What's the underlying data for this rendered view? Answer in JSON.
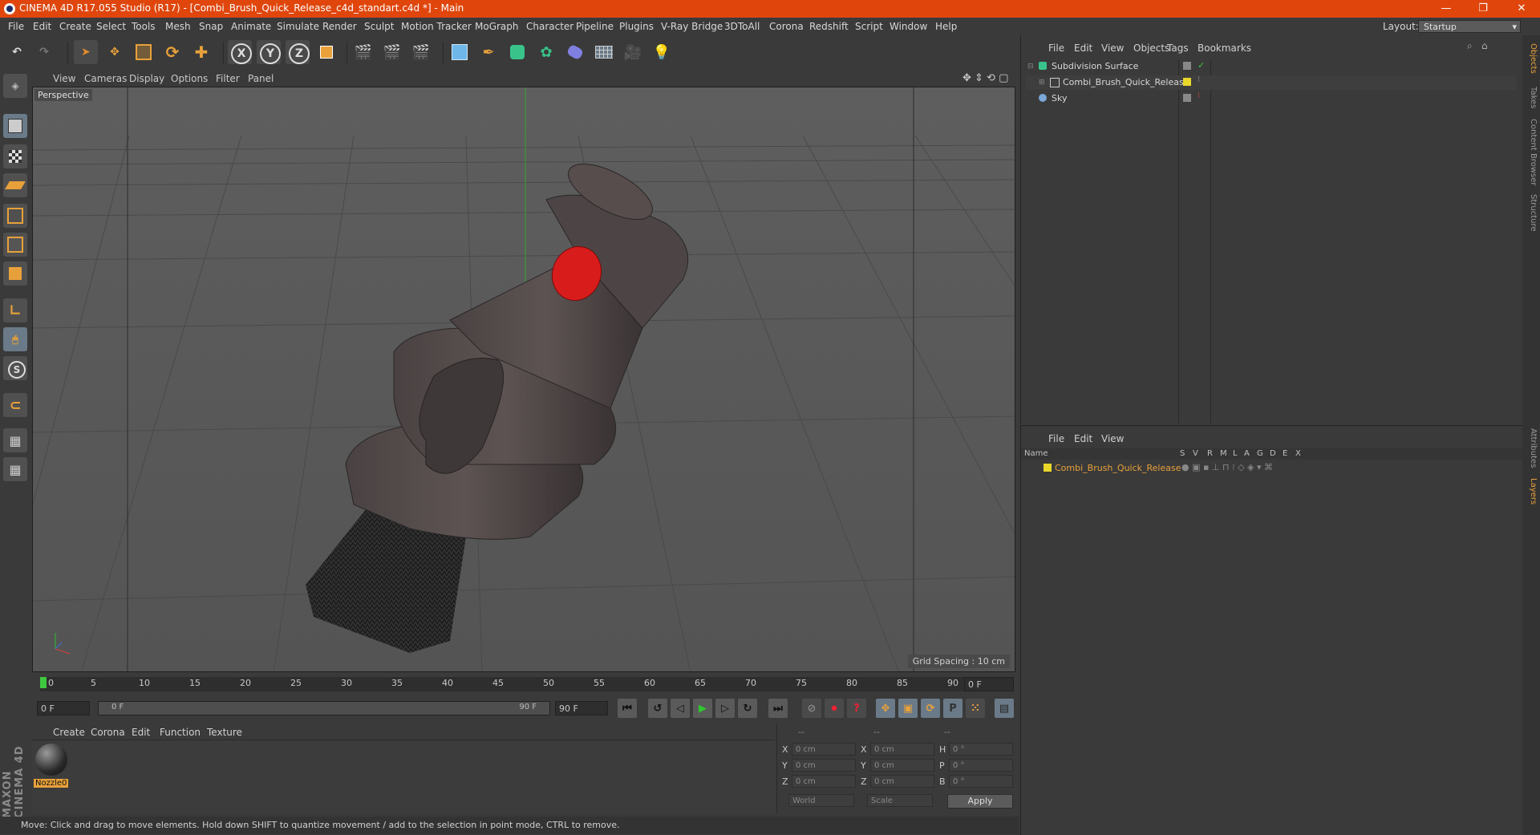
{
  "window": {
    "title": "CINEMA 4D R17.055 Studio (R17) - [Combi_Brush_Quick_Release_c4d_standart.c4d *] - Main",
    "minimize": "—",
    "restore": "❐",
    "close": "✕"
  },
  "menubar": {
    "items": [
      "File",
      "Edit",
      "Create",
      "Select",
      "Tools",
      "Mesh",
      "Snap",
      "Animate",
      "Simulate",
      "Render",
      "Sculpt",
      "Motion Tracker",
      "MoGraph",
      "Character",
      "Pipeline",
      "Plugins",
      "V-Ray Bridge",
      "3DToAll",
      "Corona",
      "Redshift",
      "Script",
      "Window",
      "Help"
    ],
    "layout_label": "Layout:",
    "layout_value": "Startup"
  },
  "toolbar": {
    "axis_x": "X",
    "axis_y": "Y",
    "axis_z": "Z"
  },
  "viewport": {
    "menu": [
      "View",
      "Cameras",
      "Display",
      "Options",
      "Filter",
      "Panel"
    ],
    "camera": "Perspective",
    "grid_spacing": "Grid Spacing : 10 cm"
  },
  "timeline": {
    "ticks": [
      "0",
      "5",
      "10",
      "15",
      "20",
      "25",
      "30",
      "35",
      "40",
      "45",
      "50",
      "55",
      "60",
      "65",
      "70",
      "75",
      "80",
      "85",
      "90"
    ],
    "current_frame": "0 F",
    "start_field": "0 F",
    "range_start": "0 F",
    "range_end": "90 F",
    "end_field": "90 F"
  },
  "material_manager": {
    "menu": [
      "Create",
      "Corona",
      "Edit",
      "Function",
      "Texture"
    ],
    "materials": [
      {
        "name": "Nozzle0"
      }
    ]
  },
  "coordinates": {
    "headers": [
      "--",
      "--",
      "--"
    ],
    "rows": [
      {
        "a": "X",
        "av": "0 cm",
        "b": "X",
        "bv": "0 cm",
        "c": "H",
        "cv": "0 °"
      },
      {
        "a": "Y",
        "av": "0 cm",
        "b": "Y",
        "bv": "0 cm",
        "c": "P",
        "cv": "0 °"
      },
      {
        "a": "Z",
        "av": "0 cm",
        "b": "Z",
        "bv": "0 cm",
        "c": "B",
        "cv": "0 °"
      }
    ],
    "world": "World",
    "scale": "Scale",
    "apply": "Apply"
  },
  "status": "Move: Click and drag to move elements. Hold down SHIFT to quantize movement / add to the selection in point mode, CTRL to remove.",
  "object_manager": {
    "menu": [
      "File",
      "Edit",
      "View",
      "Objects",
      "Tags",
      "Bookmarks"
    ],
    "objects": [
      {
        "name": "Subdivision Surface",
        "color": "#39c38a"
      },
      {
        "name": "Combi_Brush_Quick_Release",
        "color": "#cfcfcf"
      },
      {
        "name": "Sky",
        "color": "#7aa6d8"
      }
    ]
  },
  "layer_manager": {
    "menu": [
      "File",
      "Edit",
      "View"
    ],
    "columns": [
      "Name",
      "S",
      "V",
      "R",
      "M",
      "L",
      "A",
      "G",
      "D",
      "E",
      "X"
    ],
    "layers": [
      {
        "name": "Combi_Brush_Quick_Release",
        "color": "#e8d72a"
      }
    ]
  },
  "right_tabs": [
    "Objects",
    "Takes",
    "Content Browser",
    "Structure",
    "Attributes",
    "Layers"
  ],
  "brand": "MAXON CINEMA 4D",
  "colors": {
    "accent": "#e0460c",
    "selected_text": "#e8a13a",
    "layer_yellow": "#e8d72a"
  }
}
